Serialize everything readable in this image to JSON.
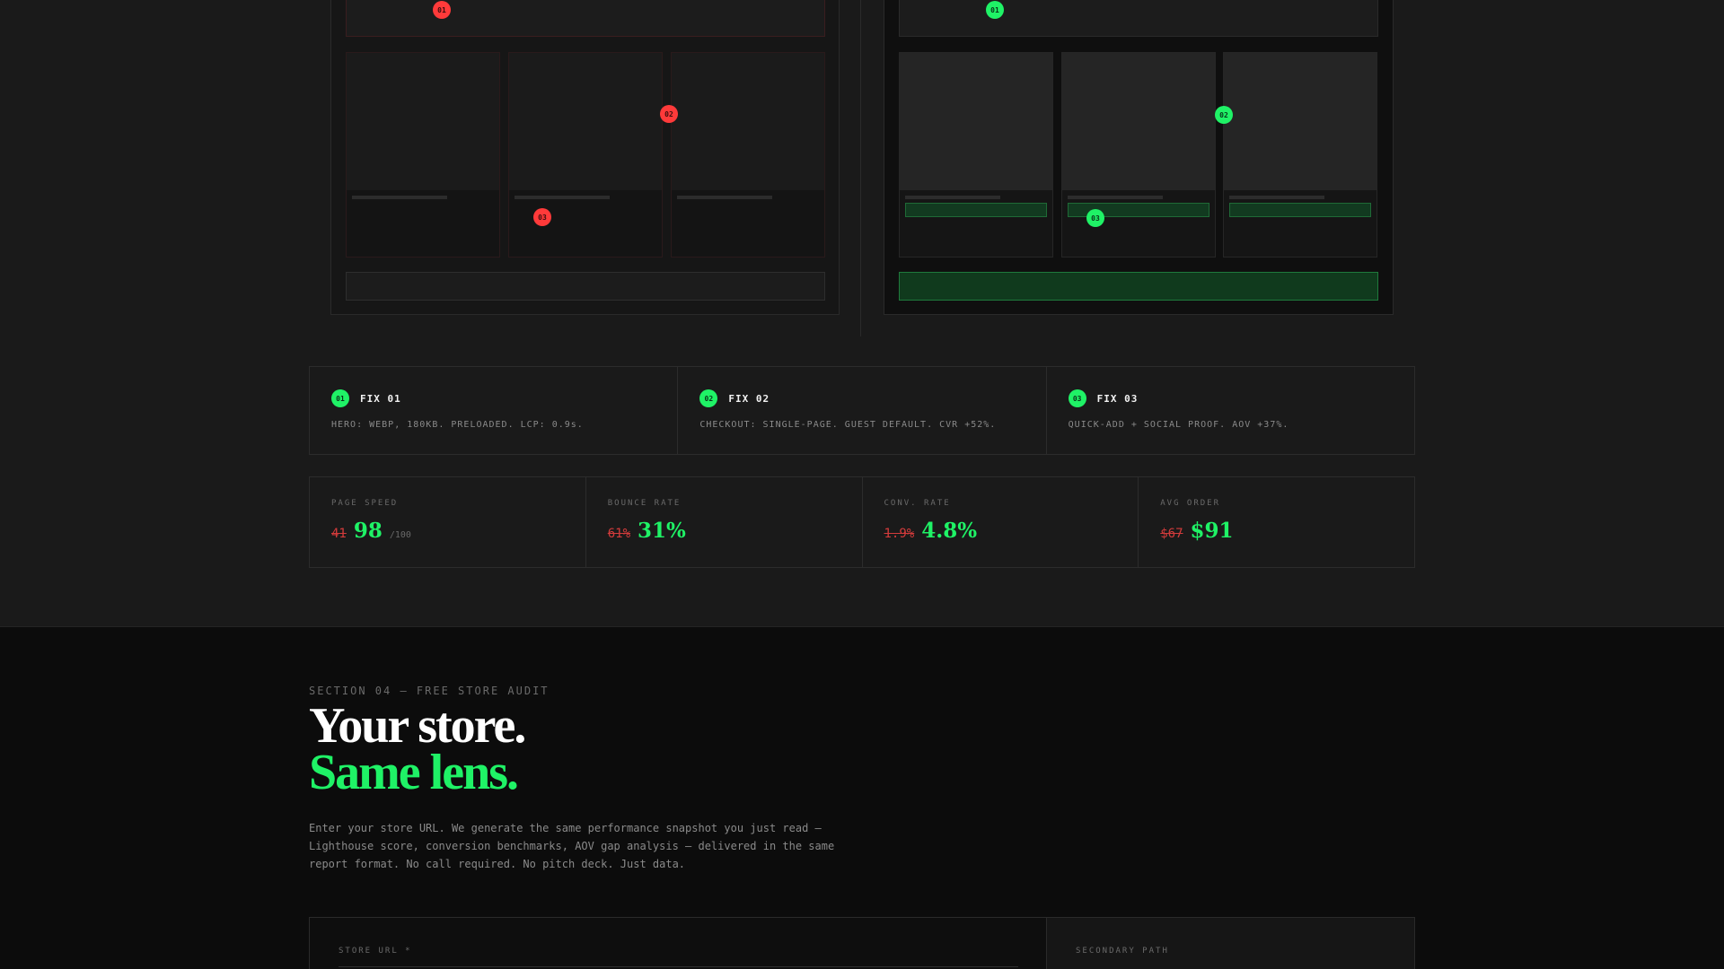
{
  "comparison": {
    "before_markers": [
      "01",
      "02",
      "03"
    ],
    "after_markers": [
      "01",
      "02",
      "03"
    ]
  },
  "fixes": [
    {
      "num": "01",
      "title": "FIX 01",
      "desc": "HERO: WEBP, 180KB. PRELOADED. LCP: 0.9s."
    },
    {
      "num": "02",
      "title": "FIX 02",
      "desc": "CHECKOUT: SINGLE-PAGE. GUEST DEFAULT. CVR +52%."
    },
    {
      "num": "03",
      "title": "FIX 03",
      "desc": "QUICK-ADD + SOCIAL PROOF. AOV +37%."
    }
  ],
  "metrics": [
    {
      "label": "PAGE SPEED",
      "old": "41",
      "new": "98",
      "unit": "/100"
    },
    {
      "label": "BOUNCE RATE",
      "old": "61%",
      "new": "31%",
      "unit": ""
    },
    {
      "label": "CONV. RATE",
      "old": "1.9%",
      "new": "4.8%",
      "unit": ""
    },
    {
      "label": "AVG ORDER",
      "old": "$67",
      "new": "$91",
      "unit": ""
    }
  ],
  "audit": {
    "section_label": "SECTION 04 — FREE STORE AUDIT",
    "headline_line1": "Your store.",
    "headline_line2": "Same lens.",
    "intro": "Enter your store URL. We generate the same performance snapshot you just read — Lighthouse score, conversion benchmarks, AOV gap analysis — delivered in the same report format. No call required. No pitch deck. Just data.",
    "store_url_label": "STORE URL *",
    "store_url_value": "",
    "secondary_label": "SECONDARY PATH"
  },
  "colors": {
    "accent_green": "#1ff266",
    "alert_red": "#ff3a3a",
    "background": "#1a1a1a",
    "background_dark": "#0c0c0c"
  }
}
